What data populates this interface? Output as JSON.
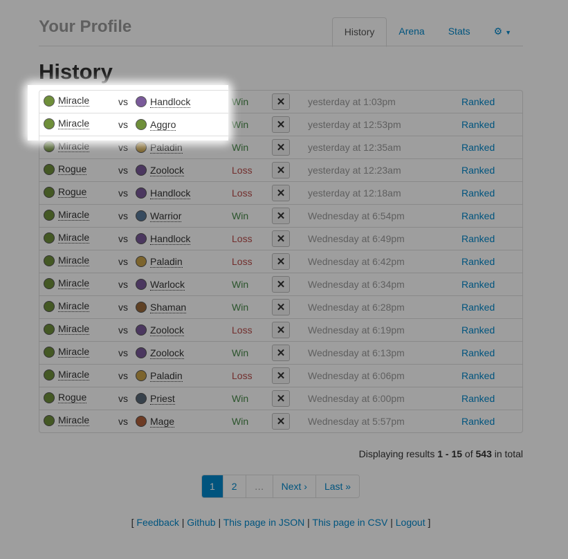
{
  "header": {
    "brand": "Your Profile",
    "tabs": [
      {
        "label": "History",
        "active": true
      },
      {
        "label": "Arena"
      },
      {
        "label": "Stats"
      }
    ],
    "settings_icon": "gear-icon",
    "caret_icon": "caret-down-icon"
  },
  "page": {
    "title": "History"
  },
  "vs_text": "vs",
  "rows": [
    {
      "deck": "Miracle",
      "deck_color": "#6f8f3a",
      "opponent": "Handlock",
      "opp_color": "#7a5a9a",
      "result": "Win",
      "time": "yesterday at 1:03pm",
      "mode": "Ranked"
    },
    {
      "deck": "Miracle",
      "deck_color": "#6f8f3a",
      "opponent": "Aggro",
      "opp_color": "#6f8f3a",
      "result": "Win",
      "time": "yesterday at 12:53pm",
      "mode": "Ranked"
    },
    {
      "deck": "Miracle",
      "deck_color": "#6f8f3a",
      "opponent": "Paladin",
      "opp_color": "#c9a24a",
      "result": "Win",
      "time": "yesterday at 12:35am",
      "mode": "Ranked"
    },
    {
      "deck": "Rogue",
      "deck_color": "#6f8f3a",
      "opponent": "Zoolock",
      "opp_color": "#7a5a9a",
      "result": "Loss",
      "time": "yesterday at 12:23am",
      "mode": "Ranked"
    },
    {
      "deck": "Rogue",
      "deck_color": "#6f8f3a",
      "opponent": "Handlock",
      "opp_color": "#7a5a9a",
      "result": "Loss",
      "time": "yesterday at 12:18am",
      "mode": "Ranked"
    },
    {
      "deck": "Miracle",
      "deck_color": "#6f8f3a",
      "opponent": "Warrior",
      "opp_color": "#5a7a9a",
      "result": "Win",
      "time": "Wednesday at 6:54pm",
      "mode": "Ranked"
    },
    {
      "deck": "Miracle",
      "deck_color": "#6f8f3a",
      "opponent": "Handlock",
      "opp_color": "#7a5a9a",
      "result": "Loss",
      "time": "Wednesday at 6:49pm",
      "mode": "Ranked"
    },
    {
      "deck": "Miracle",
      "deck_color": "#6f8f3a",
      "opponent": "Paladin",
      "opp_color": "#c9a24a",
      "result": "Loss",
      "time": "Wednesday at 6:42pm",
      "mode": "Ranked"
    },
    {
      "deck": "Miracle",
      "deck_color": "#6f8f3a",
      "opponent": "Warlock",
      "opp_color": "#7a5a9a",
      "result": "Win",
      "time": "Wednesday at 6:34pm",
      "mode": "Ranked"
    },
    {
      "deck": "Miracle",
      "deck_color": "#6f8f3a",
      "opponent": "Shaman",
      "opp_color": "#9a6a3a",
      "result": "Win",
      "time": "Wednesday at 6:28pm",
      "mode": "Ranked"
    },
    {
      "deck": "Miracle",
      "deck_color": "#6f8f3a",
      "opponent": "Zoolock",
      "opp_color": "#7a5a9a",
      "result": "Loss",
      "time": "Wednesday at 6:19pm",
      "mode": "Ranked"
    },
    {
      "deck": "Miracle",
      "deck_color": "#6f8f3a",
      "opponent": "Zoolock",
      "opp_color": "#7a5a9a",
      "result": "Win",
      "time": "Wednesday at 6:13pm",
      "mode": "Ranked"
    },
    {
      "deck": "Miracle",
      "deck_color": "#6f8f3a",
      "opponent": "Paladin",
      "opp_color": "#c9a24a",
      "result": "Loss",
      "time": "Wednesday at 6:06pm",
      "mode": "Ranked"
    },
    {
      "deck": "Rogue",
      "deck_color": "#6f8f3a",
      "opponent": "Priest",
      "opp_color": "#5a6a7a",
      "result": "Win",
      "time": "Wednesday at 6:00pm",
      "mode": "Ranked"
    },
    {
      "deck": "Miracle",
      "deck_color": "#6f8f3a",
      "opponent": "Mage",
      "opp_color": "#b0603a",
      "result": "Win",
      "time": "Wednesday at 5:57pm",
      "mode": "Ranked"
    }
  ],
  "results": {
    "prefix": "Displaying results",
    "range": "1 - 15",
    "of": "of",
    "total": "543",
    "suffix": "in total"
  },
  "pagination": [
    "1",
    "2",
    "…",
    "Next ›",
    "Last »"
  ],
  "footer": {
    "open": "[",
    "close": "]",
    "sep": "|",
    "links": [
      "Feedback",
      "Github",
      "This page in JSON",
      "This page in CSV",
      "Logout"
    ]
  },
  "colors": {
    "win": "#468847",
    "loss": "#b94a48",
    "link": "#0088cc"
  }
}
